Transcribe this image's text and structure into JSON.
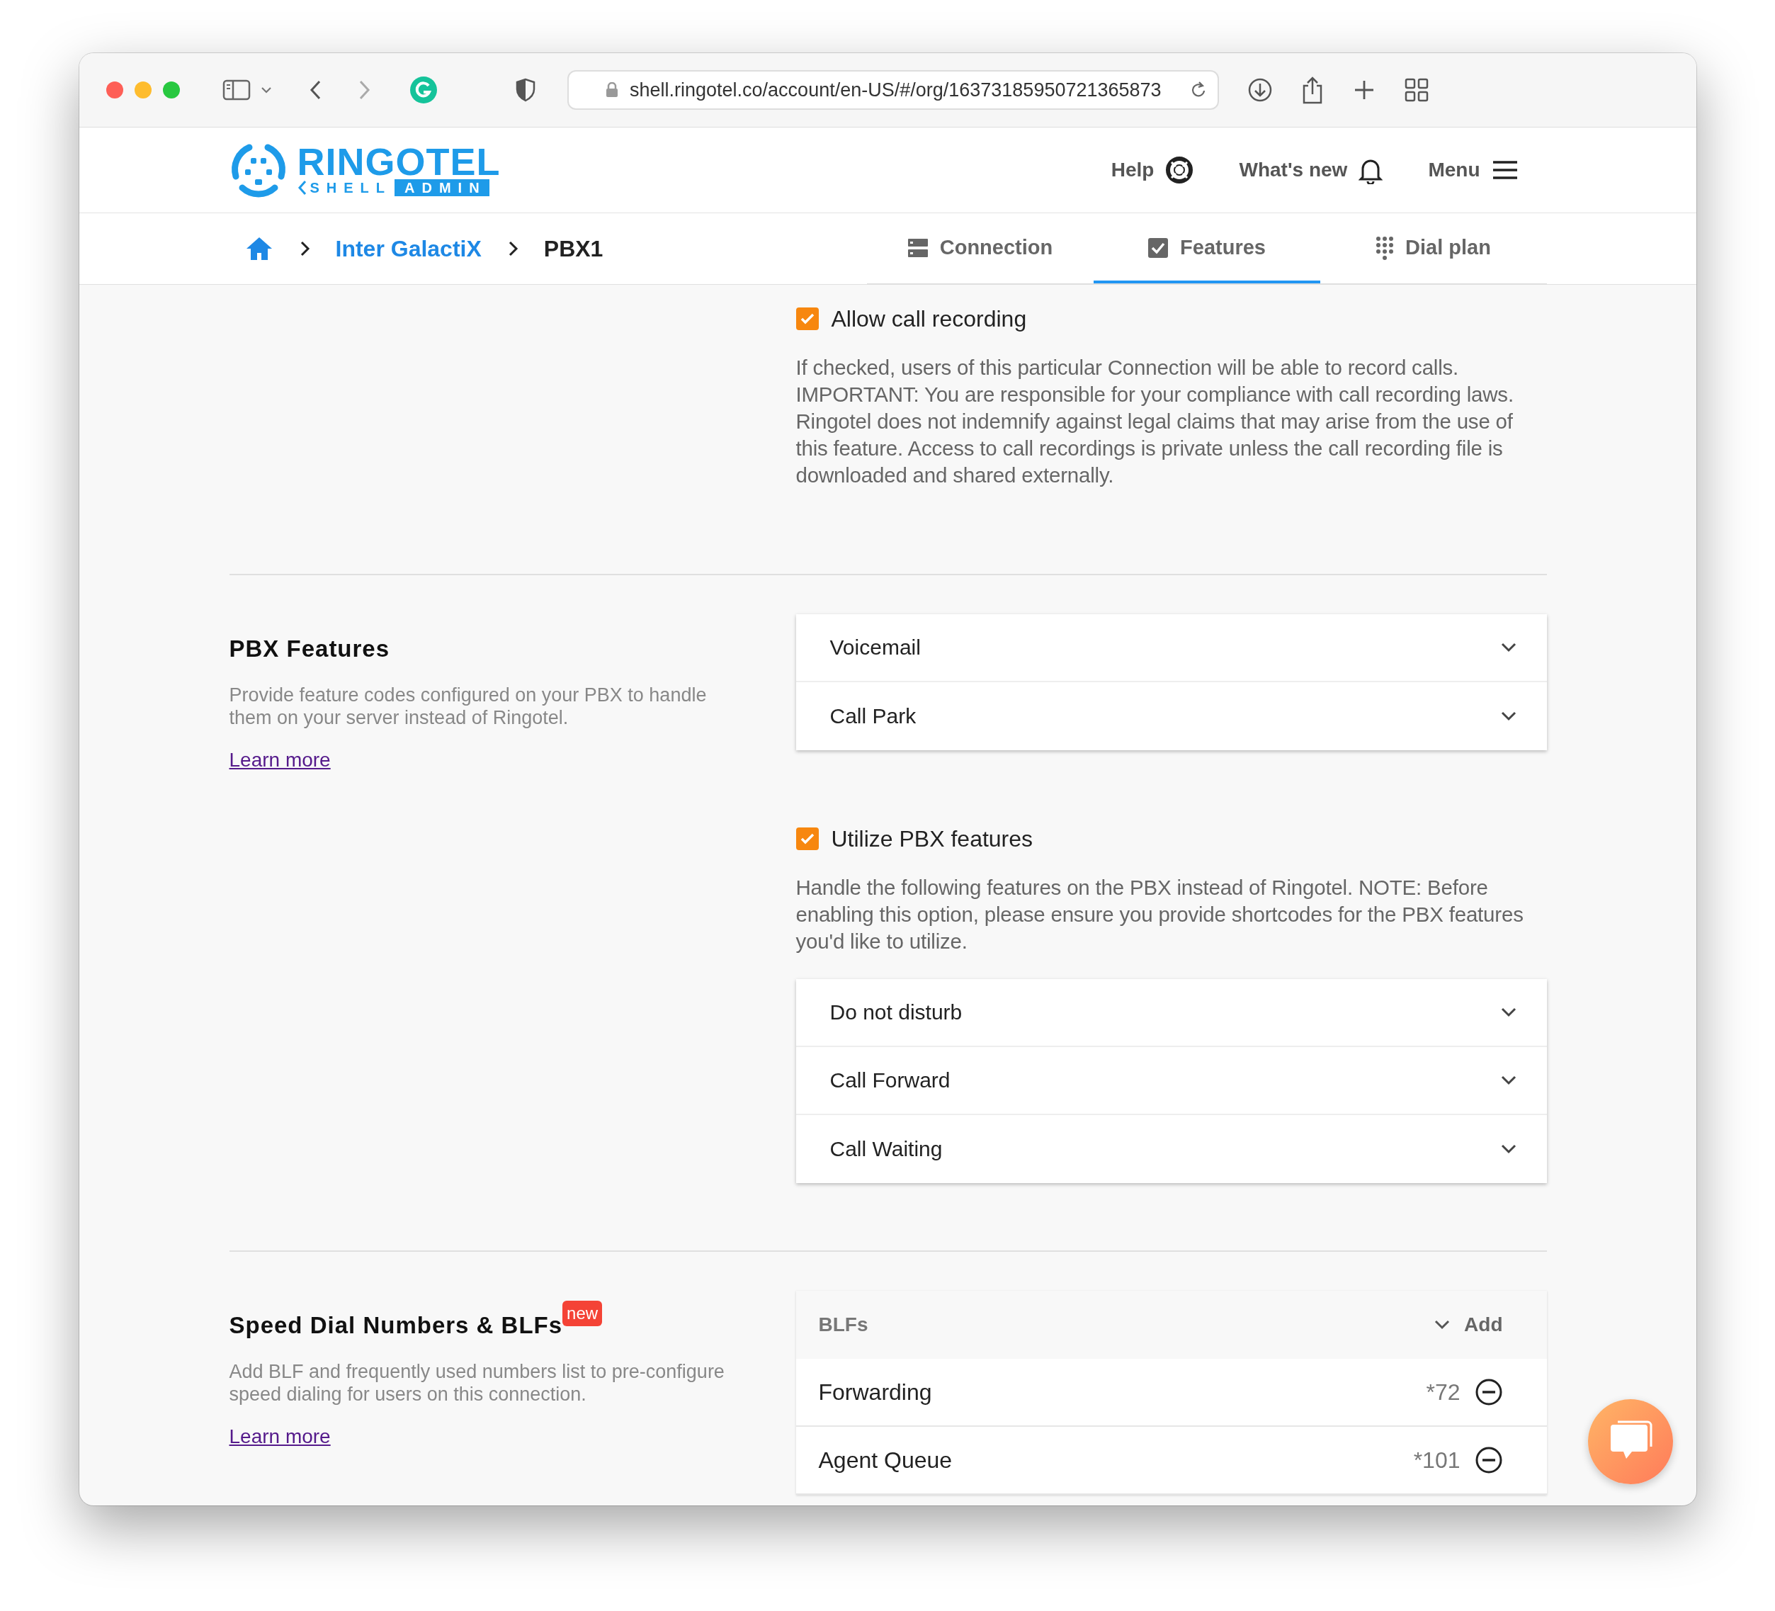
{
  "browser": {
    "url": "shell.ringotel.co/account/en-US/#/org/16373185950721365873"
  },
  "header": {
    "logo": {
      "name": "RINGOTEL",
      "sub_left": "SHELL",
      "sub_right": "ADMIN"
    },
    "nav": [
      {
        "label": "Help",
        "kind": "help"
      },
      {
        "label": "What's new",
        "kind": "bell"
      },
      {
        "label": "Menu",
        "kind": "menu"
      }
    ]
  },
  "breadcrumb": [
    {
      "label": "Inter GalactiX",
      "kind": "link"
    },
    {
      "label": "PBX1",
      "kind": "current"
    }
  ],
  "tabs": [
    {
      "label": "Connection",
      "kind": "server",
      "selected": false
    },
    {
      "label": "Features",
      "kind": "check",
      "selected": true
    },
    {
      "label": "Dial plan",
      "kind": "dots",
      "selected": false
    }
  ],
  "recording": {
    "checkbox": {
      "label": "Allow call recording",
      "checked": true
    },
    "description": "If checked, users of this particular Connection will be able to record calls. IMPORTANT: You are responsible for your compliance with call recording laws. Ringotel does not indemnify against legal claims that may arise from the use of this feature. Access to call recordings is private unless the call recording file is downloaded and shared externally."
  },
  "pbx_features": {
    "title": "PBX Features",
    "description": "Provide feature codes configured on your PBX to handle them on your server instead of Ringotel.",
    "link": "Learn more",
    "codes": [
      {
        "label": "Voicemail",
        "expanded": false
      },
      {
        "label": "Call Park",
        "expanded": false
      }
    ],
    "checkbox": {
      "label": "Utilize PBX features",
      "checked": true
    },
    "note": "Handle the following features on the PBX instead of Ringotel. NOTE: Before enabling this option, please ensure you provide shortcodes for the PBX features you'd like to utilize.",
    "features": [
      {
        "label": "Do not disturb",
        "expanded": false
      },
      {
        "label": "Call Forward",
        "expanded": false
      },
      {
        "label": "Call Waiting",
        "expanded": false
      }
    ]
  },
  "speed_dial": {
    "title": "Speed Dial Numbers & BLFs",
    "badge": "new",
    "description": "Add BLF and frequently used numbers list to pre-configure speed dialing for users on this connection.",
    "link": "Learn more",
    "blfs": {
      "title": "BLFs",
      "add": "Add",
      "rows": [
        {
          "name": "Forwarding",
          "code": "*72"
        },
        {
          "name": "Agent Queue",
          "code": "*101"
        }
      ]
    }
  }
}
